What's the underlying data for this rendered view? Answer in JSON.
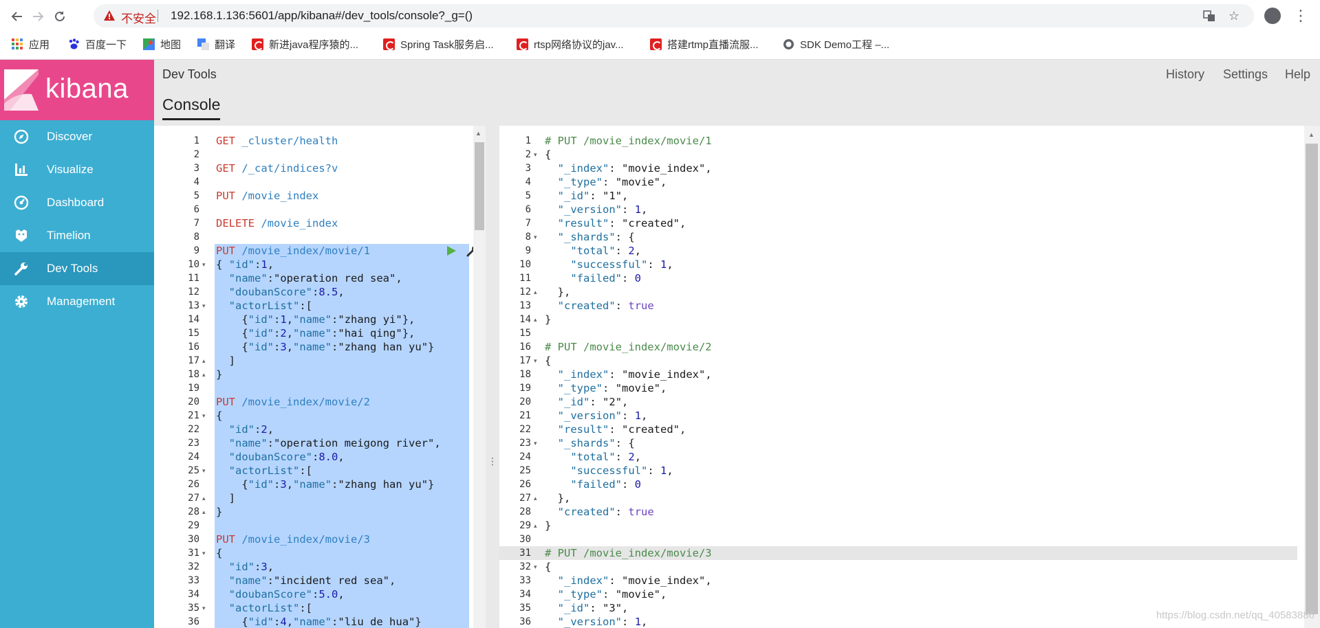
{
  "browser": {
    "insecure_label": "不安全",
    "url": "192.168.1.136:5601/app/kibana#/dev_tools/console?_g=()",
    "bookmarks": [
      "应用",
      "百度一下",
      "地图",
      "翻译",
      "新进java程序猿的...",
      "Spring Task服务启...",
      "rtsp网络协议的jav...",
      "搭建rtmp直播流服...",
      "SDK Demo工程 –..."
    ]
  },
  "sidebar": {
    "logo": "kibana",
    "items": [
      {
        "label": "Discover",
        "icon": "compass-icon"
      },
      {
        "label": "Visualize",
        "icon": "bar-chart-icon"
      },
      {
        "label": "Dashboard",
        "icon": "dashboard-icon"
      },
      {
        "label": "Timelion",
        "icon": "timelion-icon"
      },
      {
        "label": "Dev Tools",
        "icon": "wrench-icon",
        "active": true
      },
      {
        "label": "Management",
        "icon": "gear-icon"
      }
    ]
  },
  "header": {
    "title": "Dev Tools",
    "links": [
      "History",
      "Settings",
      "Help"
    ],
    "tab": "Console"
  },
  "editor": {
    "lines": [
      "GET _cluster/health",
      "",
      "GET /_cat/indices?v",
      "",
      "PUT /movie_index",
      "",
      "DELETE /movie_index",
      "",
      "PUT /movie_index/movie/1",
      "{ \"id\":1,",
      "  \"name\":\"operation red sea\",",
      "  \"doubanScore\":8.5,",
      "  \"actorList\":[",
      "    {\"id\":1,\"name\":\"zhang yi\"},",
      "    {\"id\":2,\"name\":\"hai qing\"},",
      "    {\"id\":3,\"name\":\"zhang han yu\"}",
      "  ]",
      "}",
      "",
      "PUT /movie_index/movie/2",
      "{",
      "  \"id\":2,",
      "  \"name\":\"operation meigong river\",",
      "  \"doubanScore\":8.0,",
      "  \"actorList\":[",
      "    {\"id\":3,\"name\":\"zhang han yu\"}",
      "  ]",
      "}",
      "",
      "PUT /movie_index/movie/3",
      "{",
      "  \"id\":3,",
      "  \"name\":\"incident red sea\",",
      "  \"doubanScore\":5.0,",
      "  \"actorList\":[",
      "    {\"id\":4,\"name\":\"liu de hua\"}"
    ],
    "folds": {
      "10": "down",
      "13": "down",
      "17": "up",
      "18": "up",
      "21": "down",
      "25": "down",
      "27": "up",
      "28": "up",
      "31": "down",
      "35": "down"
    },
    "selection": {
      "from_line": 9,
      "to_line": 36
    }
  },
  "output": {
    "lines": [
      "# PUT /movie_index/movie/1",
      "{",
      "  \"_index\": \"movie_index\",",
      "  \"_type\": \"movie\",",
      "  \"_id\": \"1\",",
      "  \"_version\": 1,",
      "  \"result\": \"created\",",
      "  \"_shards\": {",
      "    \"total\": 2,",
      "    \"successful\": 1,",
      "    \"failed\": 0",
      "  },",
      "  \"created\": true",
      "}",
      "",
      "# PUT /movie_index/movie/2",
      "{",
      "  \"_index\": \"movie_index\",",
      "  \"_type\": \"movie\",",
      "  \"_id\": \"2\",",
      "  \"_version\": 1,",
      "  \"result\": \"created\",",
      "  \"_shards\": {",
      "    \"total\": 2,",
      "    \"successful\": 1,",
      "    \"failed\": 0",
      "  },",
      "  \"created\": true",
      "}",
      "",
      "# PUT /movie_index/movie/3",
      "{",
      "  \"_index\": \"movie_index\",",
      "  \"_type\": \"movie\",",
      "  \"_id\": \"3\",",
      "  \"_version\": 1,"
    ],
    "folds": {
      "2": "down",
      "8": "down",
      "12": "up",
      "14": "up",
      "17": "down",
      "23": "down",
      "27": "up",
      "29": "up",
      "32": "down"
    },
    "current_line": 31
  },
  "watermark": "https://blog.csdn.net/qq_40583886",
  "colors": {
    "kibana_pink": "#e8488b",
    "sidebar_blue": "#3caed2",
    "selection": "#b5d5ff"
  }
}
